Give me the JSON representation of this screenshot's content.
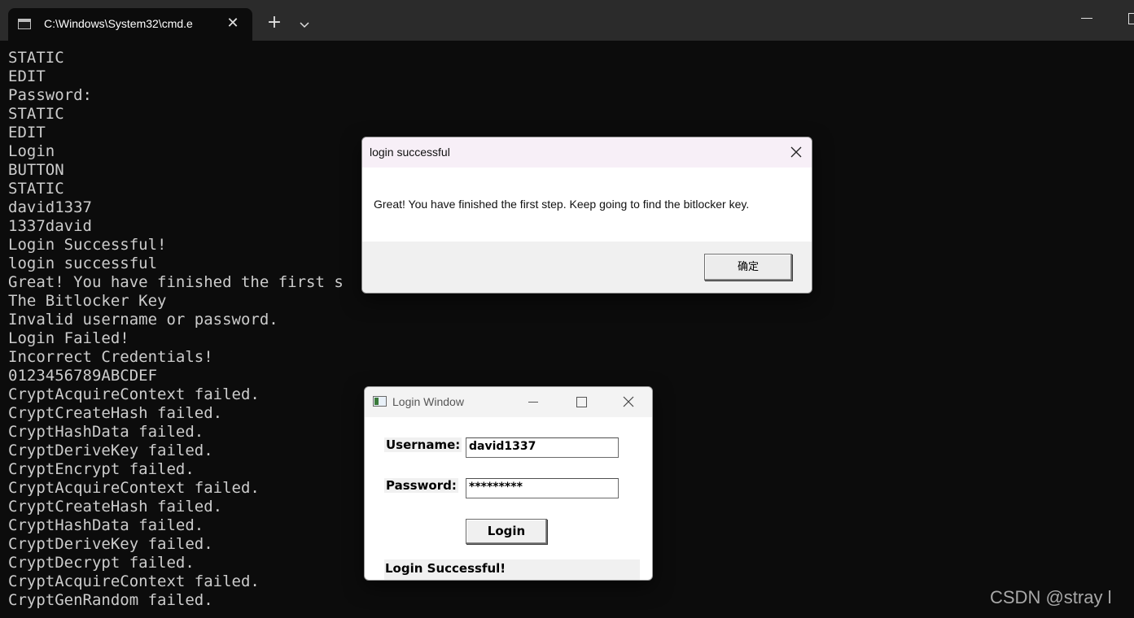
{
  "terminal": {
    "tab_title": "C:\\Windows\\System32\\cmd.e",
    "new_tab_label": "+",
    "close_glyph": "✕",
    "console_lines": [
      "STATIC",
      "EDIT",
      "Password:",
      "STATIC",
      "EDIT",
      "Login",
      "BUTTON",
      "STATIC",
      "david1337",
      "1337david",
      "Login Successful!",
      "login successful",
      "Great! You have finished the first s",
      "The Bitlocker Key",
      "Invalid username or password.",
      "Login Failed!",
      "Incorrect Credentials!",
      "0123456789ABCDEF",
      "CryptAcquireContext failed.",
      "CryptCreateHash failed.",
      "CryptHashData failed.",
      "CryptDeriveKey failed.",
      "CryptEncrypt failed.",
      "CryptAcquireContext failed.",
      "CryptCreateHash failed.",
      "CryptHashData failed.",
      "CryptDeriveKey failed.",
      "CryptDecrypt failed.",
      "CryptAcquireContext failed.",
      "CryptGenRandom failed."
    ]
  },
  "message_box": {
    "title": "login successful",
    "message": "Great! You have finished the first step. Keep going to find the bitlocker key.",
    "ok_label": "确定"
  },
  "login_window": {
    "title": "Login Window",
    "username_label": "Username:",
    "username_value": "david1337",
    "password_label": "Password:",
    "password_value": "*********",
    "login_button": "Login",
    "status_text": "Login Successful!"
  },
  "watermark": "CSDN @stray l",
  "colors": {
    "console_bg": "#0c0c0c",
    "console_text": "#cccccc",
    "titlebar_bg": "#2b2b2b",
    "msgbox_title_bg": "#f7eff7",
    "dialog_face": "#f0f0f0"
  }
}
